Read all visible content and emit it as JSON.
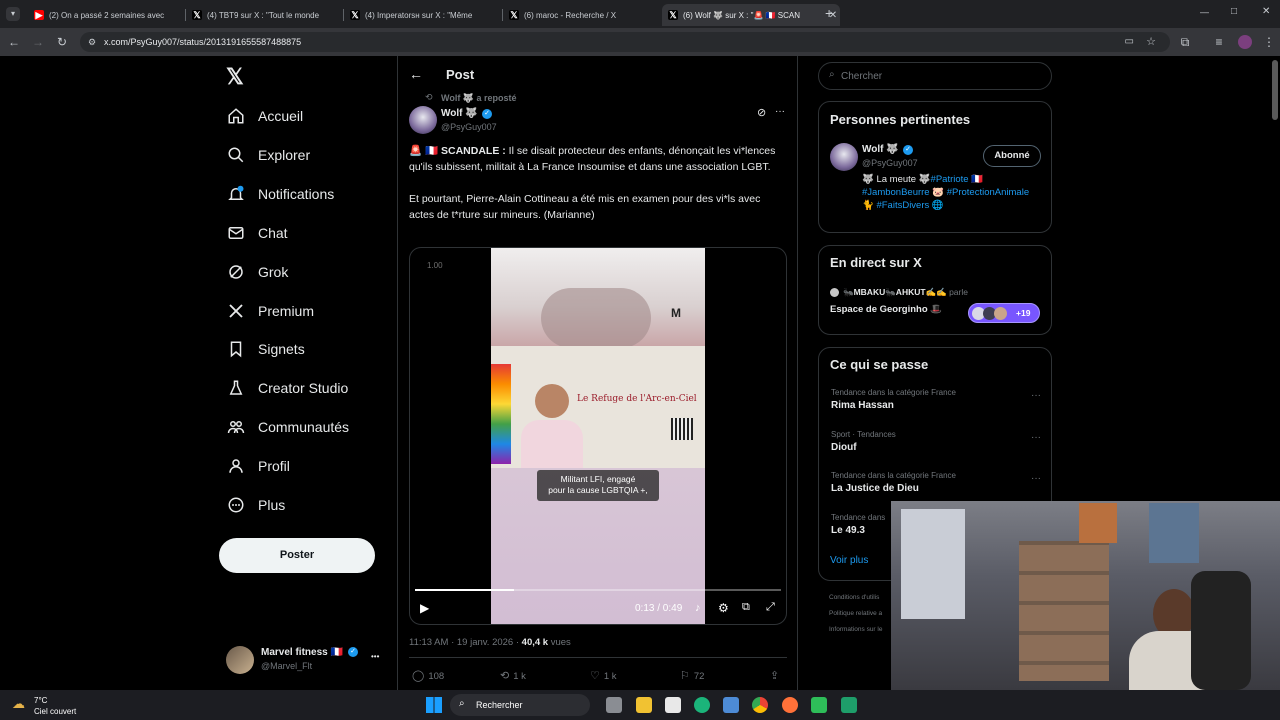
{
  "browser": {
    "tabs": [
      {
        "title": "(2) On a passé 2 semaines avec",
        "icon": "youtube-icon",
        "color": "#ff0000",
        "active": false
      },
      {
        "title": "(4) TBT9 sur X : \"Tout le monde",
        "icon": "x-logo-icon",
        "color": "#000000",
        "active": false
      },
      {
        "title": "(4) Imperatorsн sur X : \"Même",
        "icon": "x-logo-icon",
        "color": "#000000",
        "active": false
      },
      {
        "title": "(6) maroc - Recherche / X",
        "icon": "x-logo-icon",
        "color": "#000000",
        "active": false
      },
      {
        "title": "(6) Wolf 🐺 sur X : \"🚨 🇫🇷 SCAN",
        "icon": "x-logo-icon",
        "color": "#000000",
        "active": true
      }
    ],
    "new_tab": "+",
    "url": "x.com/PsyGuy007/status/2013191655587488875",
    "window_controls": [
      "—",
      "□",
      "✕"
    ]
  },
  "sidebar": {
    "logo": "𝕏",
    "items": [
      {
        "label": "Accueil",
        "icon": "home-icon",
        "bold": true
      },
      {
        "label": "Explorer",
        "icon": "search-icon"
      },
      {
        "label": "Notifications",
        "icon": "bell-icon"
      },
      {
        "label": "Chat",
        "icon": "mail-icon"
      },
      {
        "label": "Grok",
        "icon": "grok-icon"
      },
      {
        "label": "Premium",
        "icon": "x-premium-icon"
      },
      {
        "label": "Signets",
        "icon": "bookmark-icon"
      },
      {
        "label": "Creator Studio",
        "icon": "flask-icon"
      },
      {
        "label": "Communautés",
        "icon": "people-icon"
      },
      {
        "label": "Profil",
        "icon": "person-icon"
      },
      {
        "label": "Plus",
        "icon": "more-circle-icon"
      }
    ],
    "post_button": "Poster",
    "account": {
      "name": "Marvel fitness 🇫🇷",
      "handle": "@Marvel_Flt",
      "more": "•••"
    }
  },
  "post": {
    "header_title": "Post",
    "repost_line": "Wolf 🐺 a reposté",
    "author_name": "Wolf 🐺",
    "author_handle": "@PsyGuy007",
    "text_p1_badge": "🚨 🇫🇷 SCANDALE :",
    "text_p1": " Il se disait protecteur des enfants, dénonçait les vi*lences qu'ils subissent, militait à La France Insoumise et dans une association LGBT.",
    "text_p2": "Et pourtant, Pierre-Alain Cottineau a été mis en examen pour des vi*ls avec actes de t*rture sur mineurs. (Marianne)",
    "video": {
      "speed_label": "1.00",
      "banner_text": "Le Refuge de l'Arc-en-Ciel",
      "caption_line1": "Militant LFI, engagé",
      "caption_line2": "pour la cause LGBTQIA +,",
      "time": "0:13 / 0:49",
      "progress": 0.27
    },
    "timestamp": "11:13 AM · 19 janv. 2026 · ",
    "views_count": "40,4 k",
    "views_label": " vues",
    "actions": [
      {
        "icon": "reply-icon",
        "count": "108"
      },
      {
        "icon": "retweet-icon",
        "count": "1 k"
      },
      {
        "icon": "heart-icon",
        "count": "1 k"
      },
      {
        "icon": "bookmark-icon",
        "count": "72"
      },
      {
        "icon": "share-icon",
        "count": ""
      }
    ]
  },
  "right": {
    "search_placeholder": "Chercher",
    "relevant": {
      "title": "Personnes pertinentes",
      "name": "Wolf 🐺",
      "handle": "@PsyGuy007",
      "follow_button": "Abonné",
      "bio_prefix": "🐺 La meute 🐺",
      "bio_tag1": "#Patriote",
      "bio_flag": " 🇫🇷",
      "bio_tag2": "#JambonBeurre",
      "bio_pig": " 🐷",
      "bio_tag3": "#ProtectionAnimale",
      "bio_cat": " 🐈 ",
      "bio_tag4": "#FaitsDivers",
      "bio_globe": "🌐"
    },
    "live": {
      "title": "En direct sur X",
      "hosts": "🐜MBAKU🐜AHKUT✍️✍️",
      "hosts_suffix": " parle",
      "space_name": "Espace de Georginho 🎩",
      "listeners": "+19"
    },
    "trends": {
      "title": "Ce qui se passe",
      "items": [
        {
          "meta": "Tendance dans la catégorie France",
          "name": "Rima Hassan"
        },
        {
          "meta": "Sport · Tendances",
          "name": "Diouf"
        },
        {
          "meta": "Tendance dans la catégorie France",
          "name": "La Justice de Dieu"
        },
        {
          "meta": "Tendance dans",
          "name": "Le 49.3"
        }
      ],
      "show_more": "Voir plus"
    },
    "footer": [
      "Conditions d'utilis",
      "Politique relative a",
      "Informations sur le"
    ]
  },
  "taskbar": {
    "weather_temp": "7°C",
    "weather_desc": "Ciel couvert",
    "search_label": "Rechercher"
  }
}
